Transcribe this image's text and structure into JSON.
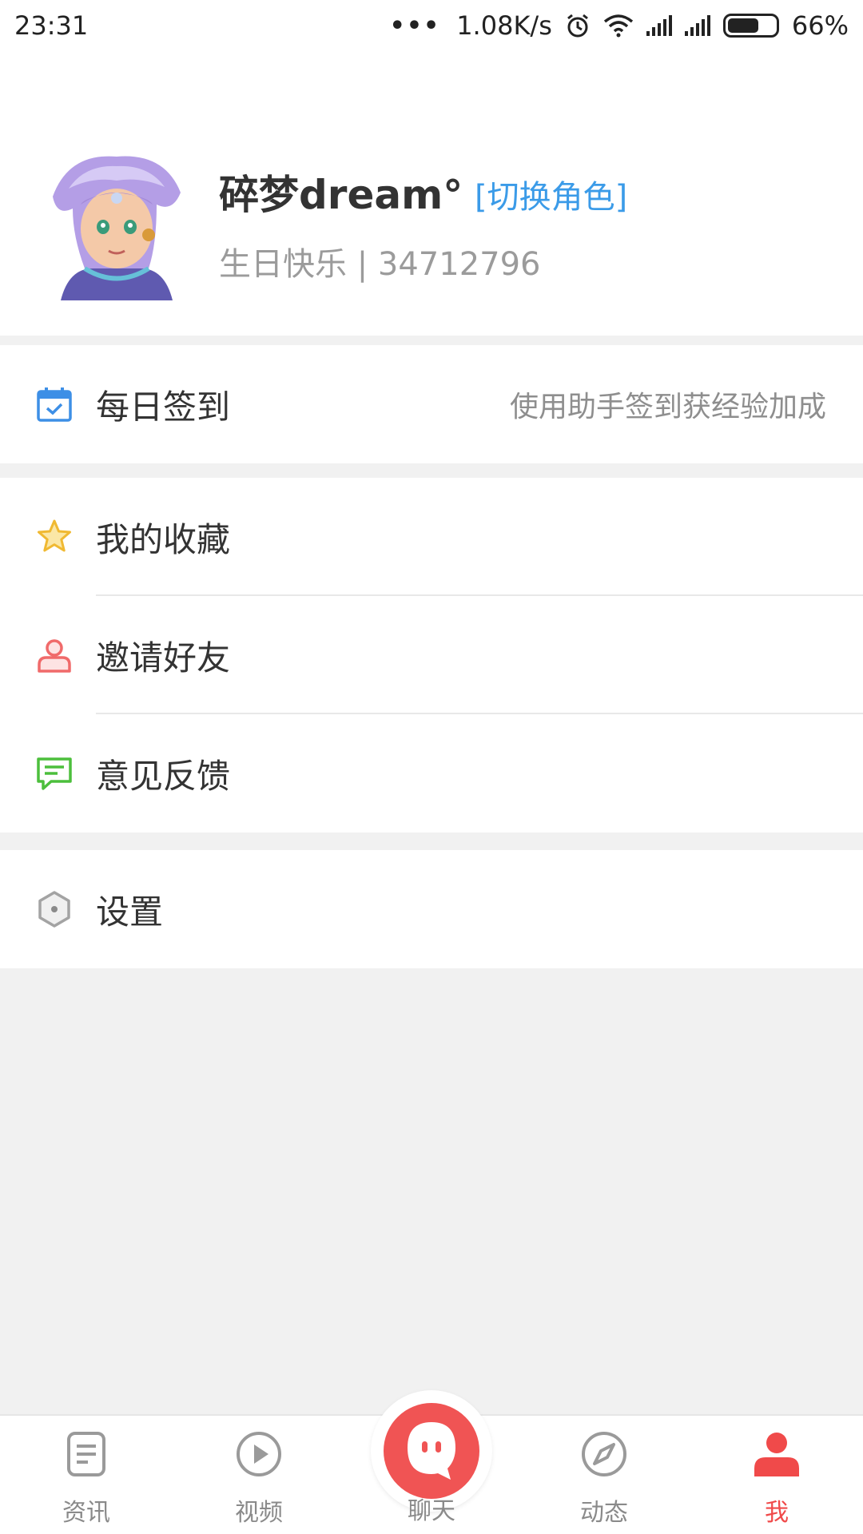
{
  "status_bar": {
    "time": "23:31",
    "more": "•••",
    "net_speed": "1.08K/s",
    "battery": "66%",
    "battery_level": 0.66
  },
  "profile": {
    "name": "碎梦dream°",
    "switch_role": "[切换角色]",
    "sub_info": "生日快乐 | 34712796"
  },
  "menu": {
    "checkin": {
      "label": "每日签到",
      "hint": "使用助手签到获经验加成",
      "icon": "calendar-check-icon",
      "color": "#3d8fe6"
    },
    "favorites": {
      "label": "我的收藏",
      "icon": "star-icon",
      "color": "#f5c342"
    },
    "invite": {
      "label": "邀请好友",
      "icon": "person-icon",
      "color": "#f06a6a"
    },
    "feedback": {
      "label": "意见反馈",
      "icon": "comment-icon",
      "color": "#4cbf3c"
    },
    "settings": {
      "label": "设置",
      "icon": "hexagon-settings-icon",
      "color": "#9a9a9a"
    }
  },
  "tabs": [
    {
      "label": "资讯",
      "icon": "news-icon"
    },
    {
      "label": "视频",
      "icon": "play-icon"
    },
    {
      "label": "聊天",
      "icon": "chat-bubble-icon"
    },
    {
      "label": "动态",
      "icon": "compass-icon"
    },
    {
      "label": "我",
      "icon": "user-icon",
      "active": true
    }
  ],
  "colors": {
    "accent": "#f04a4a",
    "link": "#3b9be8",
    "background": "#f1f1f1"
  }
}
